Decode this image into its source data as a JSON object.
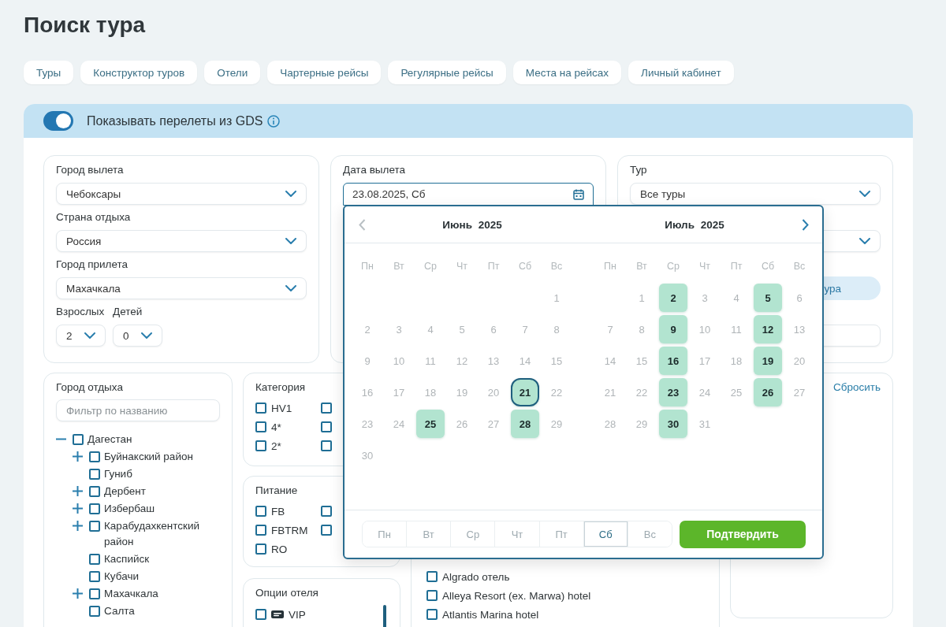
{
  "page_title": "Поиск тура",
  "tabs": [
    "Туры",
    "Конструктор туров",
    "Отели",
    "Чартерные рейсы",
    "Регулярные рейсы",
    "Места на рейсах",
    "Личный кабинет"
  ],
  "gds": {
    "on": true,
    "label": "Показывать перелеты из GDS"
  },
  "departure_panel": {
    "fields": [
      {
        "label": "Город вылета",
        "value": "Чебоксары"
      },
      {
        "label": "Страна отдыха",
        "value": "Россия"
      },
      {
        "label": "Город прилета",
        "value": "Махачкала"
      }
    ],
    "travellers": [
      {
        "label": "Взрослых",
        "value": "2"
      },
      {
        "label": "Детей",
        "value": "0"
      }
    ]
  },
  "date_panel": {
    "label": "Дата вылета",
    "value": "23.08.2025, Сб"
  },
  "tour_panel": {
    "label": "Тур",
    "value": "Все туры",
    "button_text": "ура"
  },
  "calendar": {
    "prev": {
      "disabled": true
    },
    "next": {
      "disabled": false
    },
    "months": [
      {
        "title": "Июнь 2025",
        "weekdays": [
          "Пн",
          "Вт",
          "Ср",
          "Чт",
          "Пт",
          "Сб",
          "Вс"
        ],
        "weeks": [
          {
            "ends_on_sunday": true,
            "days": [
              {
                "label": "1",
                "available": false,
                "selected": false
              }
            ]
          },
          {
            "days": [
              {
                "label": "2",
                "available": false,
                "selected": false
              },
              {
                "label": "3",
                "available": false,
                "selected": false
              },
              {
                "label": "4",
                "available": false,
                "selected": false
              },
              {
                "label": "5",
                "available": false,
                "selected": false
              },
              {
                "label": "6",
                "available": false,
                "selected": false
              },
              {
                "label": "7",
                "available": false,
                "selected": false
              },
              {
                "label": "8",
                "available": false,
                "selected": false
              }
            ]
          },
          {
            "days": [
              {
                "label": "9",
                "available": false,
                "selected": false
              },
              {
                "label": "10",
                "available": false,
                "selected": false
              },
              {
                "label": "11",
                "available": false,
                "selected": false
              },
              {
                "label": "12",
                "available": false,
                "selected": false
              },
              {
                "label": "13",
                "available": false,
                "selected": false
              },
              {
                "label": "14",
                "available": false,
                "selected": false
              },
              {
                "label": "15",
                "available": false,
                "selected": false
              }
            ]
          },
          {
            "days": [
              {
                "label": "16",
                "available": false,
                "selected": false
              },
              {
                "label": "17",
                "available": false,
                "selected": false
              },
              {
                "label": "18",
                "available": false,
                "selected": false
              },
              {
                "label": "19",
                "available": false,
                "selected": false
              },
              {
                "label": "20",
                "available": false,
                "selected": false
              },
              {
                "label": "21",
                "available": true,
                "selected": true
              },
              {
                "label": "22",
                "available": false,
                "selected": false
              }
            ]
          },
          {
            "days": [
              {
                "label": "23",
                "available": false,
                "selected": false
              },
              {
                "label": "24",
                "available": false,
                "selected": false
              },
              {
                "label": "25",
                "available": true,
                "selected": false
              },
              {
                "label": "26",
                "available": false,
                "selected": false
              },
              {
                "label": "27",
                "available": false,
                "selected": false
              },
              {
                "label": "28",
                "available": true,
                "selected": false
              },
              {
                "label": "29",
                "available": false,
                "selected": false
              }
            ]
          },
          {
            "ends_on_sunday": false,
            "days": [
              {
                "label": "30",
                "available": false,
                "selected": false
              }
            ]
          }
        ]
      },
      {
        "title": "Июль 2025",
        "weekdays": [
          "Пн",
          "Вт",
          "Ср",
          "Чт",
          "Пт",
          "Сб",
          "Вс"
        ],
        "weeks": [
          {
            "ends_on_sunday": true,
            "days": [
              {
                "label": "1",
                "available": false,
                "selected": false
              },
              {
                "label": "2",
                "available": true,
                "selected": false
              },
              {
                "label": "3",
                "available": false,
                "selected": false
              },
              {
                "label": "4",
                "available": false,
                "selected": false
              },
              {
                "label": "5",
                "available": true,
                "selected": false
              },
              {
                "label": "6",
                "available": false,
                "selected": false
              }
            ]
          },
          {
            "days": [
              {
                "label": "7",
                "available": false,
                "selected": false
              },
              {
                "label": "8",
                "available": false,
                "selected": false
              },
              {
                "label": "9",
                "available": true,
                "selected": false
              },
              {
                "label": "10",
                "available": false,
                "selected": false
              },
              {
                "label": "11",
                "available": false,
                "selected": false
              },
              {
                "label": "12",
                "available": true,
                "selected": false
              },
              {
                "label": "13",
                "available": false,
                "selected": false
              }
            ]
          },
          {
            "days": [
              {
                "label": "14",
                "available": false,
                "selected": false
              },
              {
                "label": "15",
                "available": false,
                "selected": false
              },
              {
                "label": "16",
                "available": true,
                "selected": false
              },
              {
                "label": "17",
                "available": false,
                "selected": false
              },
              {
                "label": "18",
                "available": false,
                "selected": false
              },
              {
                "label": "19",
                "available": true,
                "selected": false
              },
              {
                "label": "20",
                "available": false,
                "selected": false
              }
            ]
          },
          {
            "days": [
              {
                "label": "21",
                "available": false,
                "selected": false
              },
              {
                "label": "22",
                "available": false,
                "selected": false
              },
              {
                "label": "23",
                "available": true,
                "selected": false
              },
              {
                "label": "24",
                "available": false,
                "selected": false
              },
              {
                "label": "25",
                "available": false,
                "selected": false
              },
              {
                "label": "26",
                "available": true,
                "selected": false
              },
              {
                "label": "27",
                "available": false,
                "selected": false
              }
            ]
          },
          {
            "ends_on_sunday": false,
            "days": [
              {
                "label": "28",
                "available": false,
                "selected": false
              },
              {
                "label": "29",
                "available": false,
                "selected": false
              },
              {
                "label": "30",
                "available": true,
                "selected": false
              },
              {
                "label": "31",
                "available": false,
                "selected": false
              }
            ]
          }
        ]
      }
    ],
    "weekday_filter": [
      {
        "label": "Пн",
        "selected": false
      },
      {
        "label": "Вт",
        "selected": false
      },
      {
        "label": "Ср",
        "selected": false
      },
      {
        "label": "Чт",
        "selected": false
      },
      {
        "label": "Пт",
        "selected": false
      },
      {
        "label": "Сб",
        "selected": true
      },
      {
        "label": "Вс",
        "selected": false
      }
    ],
    "confirm": "Подтвердить"
  },
  "city_panel": {
    "label": "Город отдыха",
    "filter": {
      "placeholder": "Фильтр по названию"
    },
    "tree": [
      {
        "label": "Дагестан",
        "checked": false,
        "expanded": true,
        "children": [
          {
            "label": "Буйнакский район",
            "checked": false,
            "expanded": false
          },
          {
            "label": "Гуниб",
            "checked": false
          },
          {
            "label": "Дербент",
            "checked": false,
            "expanded": false
          },
          {
            "label": "Избербаш",
            "checked": false,
            "expanded": false
          },
          {
            "label": "Карабудахкентский район",
            "checked": false,
            "expanded": false
          },
          {
            "label": "Каспийск",
            "checked": false
          },
          {
            "label": "Кубачи",
            "checked": false
          },
          {
            "label": "Махачкала",
            "checked": false,
            "expanded": false
          },
          {
            "label": "Салта",
            "checked": false
          }
        ]
      }
    ]
  },
  "category_panel": {
    "label": "Категория",
    "columns": [
      [
        {
          "label": "HV1",
          "checked": false
        },
        {
          "label": "4*",
          "checked": false
        },
        {
          "label": "2*",
          "checked": false
        }
      ],
      [
        {
          "checked": false
        },
        {
          "checked": false
        },
        {
          "checked": false
        }
      ]
    ]
  },
  "meal_panel": {
    "label": "Питание",
    "columns": [
      [
        {
          "label": "FB",
          "checked": false
        },
        {
          "label": "FBTRM",
          "checked": false
        },
        {
          "label": "RO",
          "checked": false
        }
      ],
      [
        {
          "checked": false
        },
        {
          "checked": false
        }
      ]
    ]
  },
  "options_panel": {
    "label": "Опции отеля",
    "items": [
      {
        "label": "VIP",
        "checked": false
      }
    ]
  },
  "hotels_panel": {
    "items": [
      {
        "label": "Algrado отель",
        "checked": false
      },
      {
        "label": "Alleya Resort (ex. Marwa) hotel",
        "checked": false
      },
      {
        "label": "Atlantis Marina hotel",
        "checked": false
      }
    ]
  },
  "reset_panel": {
    "link": "Сбросить"
  }
}
